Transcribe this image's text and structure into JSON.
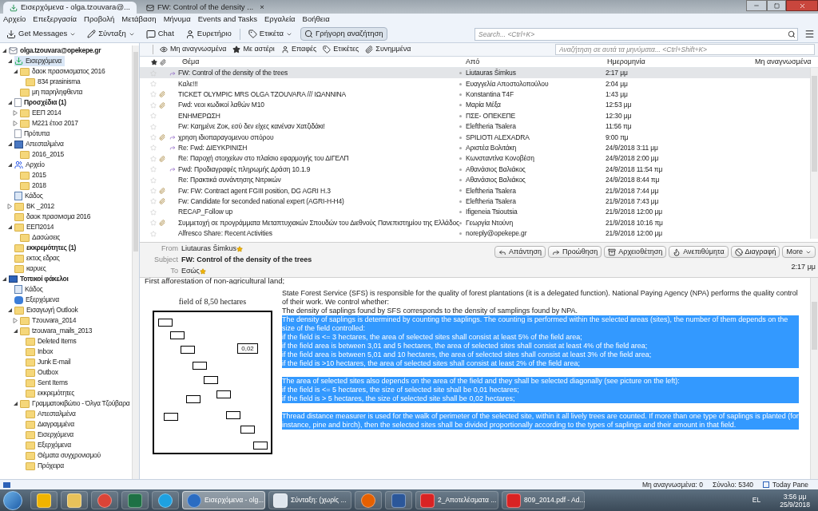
{
  "tabs": [
    {
      "label": "Εισερχόμενα - olga.tzouvara@...",
      "selected": true,
      "kind": "inbox"
    },
    {
      "label": "FW: Control of the density ...",
      "selected": false,
      "kind": "message",
      "close": "×"
    }
  ],
  "menu": [
    "Αρχείο",
    "Επεξεργασία",
    "Προβολή",
    "Μετάβαση",
    "Μήνυμα",
    "Events and Tasks",
    "Εργαλεία",
    "Βοήθεια"
  ],
  "toolbar": [
    {
      "label": "Get Messages",
      "kind": "get",
      "dropdown": true,
      "pressed": false
    },
    {
      "label": "Σύνταξη",
      "kind": "write",
      "dropdown": true,
      "pressed": false
    },
    {
      "label": "Chat",
      "kind": "chat",
      "dropdown": false,
      "pressed": false
    },
    {
      "label": "Ευρετήριο",
      "kind": "contacts",
      "dropdown": false,
      "pressed": false
    },
    {
      "label": "Ετικέτα",
      "kind": "tag",
      "dropdown": true,
      "pressed": false
    },
    {
      "label": "Γρήγορη αναζήτηση",
      "kind": "search",
      "dropdown": false,
      "pressed": true
    }
  ],
  "global_search": {
    "placeholder": "Search... <Ctrl+K>"
  },
  "folders": [
    {
      "name": "olga.tzouvara@opekepe.gr",
      "kind": "account",
      "bold": true,
      "selected": false,
      "expanded": true,
      "children": [
        {
          "name": "Εισερχόμενα",
          "kind": "inbox",
          "bold": false,
          "selected": true,
          "expanded": true,
          "children": [
            {
              "name": "δαοκ πρασινισματος 2016",
              "kind": "folder",
              "bold": false,
              "selected": false,
              "expanded": true,
              "children": [
                {
                  "name": "834 prasinisma",
                  "kind": "folder",
                  "bold": false,
                  "selected": false
                }
              ]
            },
            {
              "name": "μη παρηληφθεντα",
              "kind": "folder",
              "bold": false,
              "selected": false
            }
          ]
        },
        {
          "name": "Προσχέδια (1)",
          "kind": "drafts",
          "bold": true,
          "selected": false,
          "expanded": true,
          "children": [
            {
              "name": "ΕΕΠ 2014",
              "kind": "folder",
              "bold": false,
              "selected": false,
              "expanded": false
            },
            {
              "name": "M221 έτοσ 2017",
              "kind": "folder",
              "bold": false,
              "selected": false,
              "expanded": false
            }
          ]
        },
        {
          "name": "Πρότυπα",
          "kind": "templates",
          "bold": false,
          "selected": false
        },
        {
          "name": "Απεσταλμένα",
          "kind": "sent",
          "bold": false,
          "selected": false,
          "expanded": true,
          "children": [
            {
              "name": "2016_2015",
              "kind": "folder",
              "bold": false,
              "selected": false
            }
          ]
        },
        {
          "name": "Αρχείο",
          "kind": "archive",
          "bold": false,
          "selected": false,
          "expanded": true,
          "children": [
            {
              "name": "2015",
              "kind": "folder",
              "bold": false,
              "selected": false
            },
            {
              "name": "2018",
              "kind": "folder",
              "bold": false,
              "selected": false
            }
          ]
        },
        {
          "name": "Κάδος",
          "kind": "trash",
          "bold": false,
          "selected": false
        },
        {
          "name": "BK _2012",
          "kind": "folder",
          "bold": false,
          "selected": false,
          "expanded": false
        },
        {
          "name": "δαοκ πρασινισμα 2016",
          "kind": "folder",
          "bold": false,
          "selected": false
        },
        {
          "name": "ΕΕΠ2014",
          "kind": "folder",
          "bold": false,
          "selected": false,
          "expanded": true,
          "children": [
            {
              "name": "Δασώσεις",
              "kind": "folder",
              "bold": false,
              "selected": false
            }
          ]
        },
        {
          "name": "εκκρεμότητες (1)",
          "kind": "folder",
          "bold": true,
          "selected": false
        },
        {
          "name": "εκτος εδρας",
          "kind": "folder",
          "bold": false,
          "selected": false
        },
        {
          "name": "καρυες",
          "kind": "folder",
          "bold": false,
          "selected": false
        }
      ]
    },
    {
      "name": "Τοπικοί φάκελοι",
      "kind": "local",
      "bold": true,
      "selected": false,
      "expanded": true,
      "children": [
        {
          "name": "Κάδος",
          "kind": "trash",
          "bold": false,
          "selected": false
        },
        {
          "name": "Εξερχόμενα",
          "kind": "outbox",
          "bold": false,
          "selected": false
        },
        {
          "name": "Εισαγωγή Outlook",
          "kind": "folder",
          "bold": false,
          "selected": false,
          "expanded": true,
          "children": [
            {
              "name": "Tzouvara_2014",
              "kind": "folder",
              "bold": false,
              "selected": false,
              "expanded": false
            },
            {
              "name": "tzouvara_mails_2013",
              "kind": "folder",
              "bold": false,
              "selected": false,
              "expanded": true,
              "children": [
                {
                  "name": "Deleted Items",
                  "kind": "folder",
                  "bold": false,
                  "selected": false
                },
                {
                  "name": "Inbox",
                  "kind": "folder",
                  "bold": false,
                  "selected": false
                },
                {
                  "name": "Junk E-mail",
                  "kind": "folder",
                  "bold": false,
                  "selected": false
                },
                {
                  "name": "Outbox",
                  "kind": "folder",
                  "bold": false,
                  "selected": false
                },
                {
                  "name": "Sent Items",
                  "kind": "folder",
                  "bold": false,
                  "selected": false
                },
                {
                  "name": "εκκρεμότητες",
                  "kind": "folder",
                  "bold": false,
                  "selected": false
                }
              ]
            },
            {
              "name": "Γραμματοκιβώτιο - Όλγα Τζούβαρα",
              "kind": "folder",
              "bold": false,
              "selected": false,
              "expanded": true,
              "children": [
                {
                  "name": "Απεσταλμένα",
                  "kind": "folder",
                  "bold": false,
                  "selected": false
                },
                {
                  "name": "Διαγραμμένα",
                  "kind": "folder",
                  "bold": false,
                  "selected": false
                },
                {
                  "name": "Εισερχόμενα",
                  "kind": "folder",
                  "bold": false,
                  "selected": false
                },
                {
                  "name": "Εξερχόμενα",
                  "kind": "folder",
                  "bold": false,
                  "selected": false
                },
                {
                  "name": "Θέματα συγχρονισμού",
                  "kind": "folder",
                  "bold": false,
                  "selected": false
                },
                {
                  "name": "Πρόχειρα",
                  "kind": "folder",
                  "bold": false,
                  "selected": false
                }
              ]
            }
          ]
        }
      ]
    }
  ],
  "quick_filter": {
    "buttons": [
      {
        "label": "Μη αναγνωσμένα",
        "kind": "unread"
      },
      {
        "label": "Με αστέρι",
        "kind": "star"
      },
      {
        "label": "Επαφές",
        "kind": "contacts"
      },
      {
        "label": "Ετικέτες",
        "kind": "tag"
      },
      {
        "label": "Συνημμένα",
        "kind": "attach"
      }
    ],
    "placeholder": "Αναζήτηση σε αυτά τα μηνύματα... <Ctrl+Shift+K>"
  },
  "columns": [
    "Θέμα",
    "Από",
    "Ημερομηνία",
    "Μη αναγνωσμένα"
  ],
  "messages": [
    {
      "subject": "FW: Control of the density of the trees",
      "from": "Liutauras Šimkus",
      "date": "2:17 μμ",
      "starred": false,
      "attachment": false,
      "forwarded": true,
      "selected": true
    },
    {
      "subject": "Καλε!!!",
      "from": "Ευαγγελία Αποστολοπούλου",
      "date": "2:04 μμ",
      "starred": false,
      "attachment": false,
      "forwarded": false,
      "selected": false
    },
    {
      "subject": "TICKET OLYMPIC MRS OLGA TZOUVARA  ///   ΙΩΑΝΝΙΝΑ",
      "from": "Konstantina T4F",
      "date": "1:43 μμ",
      "starred": false,
      "attachment": true,
      "forwarded": false,
      "selected": false
    },
    {
      "subject": "Fwd: νεοι κωδικοί λαθών Μ10",
      "from": "Μαρία Μέξα",
      "date": "12:53 μμ",
      "starred": false,
      "attachment": true,
      "forwarded": false,
      "selected": false
    },
    {
      "subject": "ΕΝΗΜΕΡΩΣΗ",
      "from": "ΠΣΕ- ΟΠΕΚΕΠΕ",
      "date": "12:30 μμ",
      "starred": false,
      "attachment": false,
      "forwarded": false,
      "selected": false
    },
    {
      "subject": "Fw: Καημένε Ζοκ, εσύ δεν είχες κανέναν Χατζιδάκι!",
      "from": "Eleftheria Tsalera",
      "date": "11:56 πμ",
      "starred": false,
      "attachment": false,
      "forwarded": false,
      "selected": false
    },
    {
      "subject": "χρηση ιδιοπαραγομενου σπόρου",
      "from": "SPILIOTI ALEXADRA",
      "date": "9:00 πμ",
      "starred": false,
      "attachment": true,
      "forwarded": true,
      "selected": false
    },
    {
      "subject": "Re: Fwd: ΔΙΕΥΚΡΙΝΙΣΗ",
      "from": "Αριστέα Βολιτάκη",
      "date": "24/9/2018 3:11 μμ",
      "starred": false,
      "attachment": false,
      "forwarded": true,
      "selected": false
    },
    {
      "subject": "Re: Παροχή στοιχείων στο πλαίσιο εφαρμογής του ΔΙΓΕΛΠ",
      "from": "Κωνσταντίνα Κονοβέση",
      "date": "24/9/2018 2:00 μμ",
      "starred": false,
      "attachment": true,
      "forwarded": false,
      "selected": false
    },
    {
      "subject": "Fwd: Προδιαγραφές πληρωμής Δράση 10.1.9",
      "from": "Αθανάσιος Βαλιάκος",
      "date": "24/9/2018 11:54 πμ",
      "starred": false,
      "attachment": false,
      "forwarded": true,
      "selected": false
    },
    {
      "subject": "Re: Πρακτικά συνάντησης Νιτρικών",
      "from": "Αθανάσιος Βαλιάκος",
      "date": "24/9/2018 8:44 πμ",
      "starred": false,
      "attachment": false,
      "forwarded": false,
      "selected": false
    },
    {
      "subject": "Fw: FW: Contract agent FGIII position, DG AGRI H.3",
      "from": "Eleftheria Tsalera",
      "date": "21/9/2018 7:44 μμ",
      "starred": false,
      "attachment": true,
      "forwarded": false,
      "selected": false
    },
    {
      "subject": "Fw: Candidate for seconded national expert (AGRI-H-H4)",
      "from": "Eleftheria Tsalera",
      "date": "21/9/2018 7:43 μμ",
      "starred": false,
      "attachment": true,
      "forwarded": false,
      "selected": false
    },
    {
      "subject": "RECAP_Follow up",
      "from": "Ifigeneia Tsioutsia",
      "date": "21/9/2018 12:00 μμ",
      "starred": false,
      "attachment": false,
      "forwarded": false,
      "selected": false
    },
    {
      "subject": "Συμμετοχή σε προγράμματα Μεταπτυχιακών Σπουδών του Διεθνούς Πανεπιστημίου της Ελλάδος",
      "from": "Γεωργία Ντούνη",
      "date": "21/9/2018 10:16 πμ",
      "starred": false,
      "attachment": true,
      "forwarded": false,
      "selected": false
    },
    {
      "subject": "Alfresco Share: Recent Activities",
      "from": "noreply@opekepe.gr",
      "date": "21/9/2018 12:00 μμ",
      "starred": false,
      "attachment": false,
      "forwarded": false,
      "selected": false
    }
  ],
  "header": {
    "fields": [
      {
        "label": "From",
        "value": "Liutauras Šimkus",
        "bold": false,
        "star": true
      },
      {
        "label": "Subject",
        "value": "FW: Control of the density of the trees",
        "bold": true,
        "star": false
      },
      {
        "label": "To",
        "value": "Εσώς",
        "bold": false,
        "star": true
      }
    ],
    "actions": [
      {
        "label": "Απάντηση",
        "kind": "reply"
      },
      {
        "label": "Προώθηση",
        "kind": "forward"
      },
      {
        "label": "Αρχειοθέτηση",
        "kind": "archive"
      },
      {
        "label": "Ανεπιθύμητα",
        "kind": "junk"
      },
      {
        "label": "Διαγραφή",
        "kind": "delete"
      },
      {
        "label": "More",
        "kind": "more"
      }
    ],
    "time": "2:17 μμ"
  },
  "body": {
    "top_line": "First afforestation of non-agricultural land;",
    "figure": {
      "title": "field of 8,50 hectares",
      "label": "0,02"
    },
    "paragraphs": [
      {
        "text": "State Forest Service (SFS) is responsible for the quality of forest plantations (it is a delegated function). National Paying Agency (NPA) performs the quality control of their work. We control whether:",
        "selected": false
      },
      {
        "text": "The density of saplings found by SFS corresponds to the density of samplings found by NPA.",
        "selected": false
      },
      {
        "text": "The density of saplings is determined by counting the saplings. The counting is performed within the selected areas (sites), the number of them depends on the size of the field controlled:",
        "selected": true
      },
      {
        "text": "if the field is <= 3 hectares, the area of selected sites shall consist at least 5% of the field area;",
        "selected": true
      },
      {
        "text": "if the field area is between 3,01 and 5 hectares, the area of selected sites shall consist at least 4% of the field area;",
        "selected": true
      },
      {
        "text": "if the field area is between 5,01 and 10 hectares, the area of selected sites shall consist at least 3% of the field area;",
        "selected": true
      },
      {
        "text": "if the field is >10 hectares, the area of selected sites shall consist at least 2% of the field area;",
        "selected": true,
        "gap_after": true
      },
      {
        "text": "The area of selected sites also depends on the area of the field and they shall be selected diagonally (see picture on the left):",
        "selected": true
      },
      {
        "text": "if the field is <= 5 hectares, the size of selected site shall be 0,01 hectares;",
        "selected": true
      },
      {
        "text": "if the field is > 5 hectares, the size of selected site shall be 0,02 hectares;",
        "selected": true,
        "gap_after": true
      },
      {
        "text": "Thread distance measurer is used for the walk of perimeter of the selected site, within it all lively trees are counted. If more than one type of saplings is planted (for instance, pine and birch), then the selected sites shall be divided proportionally according to the types of saplings and their amount in that field.",
        "selected": true
      }
    ]
  },
  "status_bar": {
    "unread": "Μη αναγνωσμένα: 0",
    "total": "Σύνολο: 5340",
    "today_pane": "Today Pane"
  },
  "taskbar": {
    "items": [
      {
        "kind": "outlook",
        "selected": false
      },
      {
        "kind": "explorer",
        "selected": false
      },
      {
        "kind": "chrome",
        "selected": false
      },
      {
        "kind": "excel",
        "selected": false
      },
      {
        "kind": "ie",
        "selected": false
      },
      {
        "kind": "thunderbird",
        "label": "Εισερχόμενα - olg...",
        "selected": true
      },
      {
        "kind": "compose",
        "label": "Σύνταξη: (χωρίς ...",
        "selected": false
      },
      {
        "kind": "firefox",
        "selected": false
      },
      {
        "kind": "word",
        "selected": false
      },
      {
        "kind": "pdf",
        "label": "2_Αποτελέσματα ...",
        "selected": false
      },
      {
        "kind": "pdf",
        "label": "809_2014.pdf - Ad...",
        "selected": false
      }
    ],
    "language": "EL",
    "time": "3:56 μμ",
    "date": "25/9/2018"
  }
}
